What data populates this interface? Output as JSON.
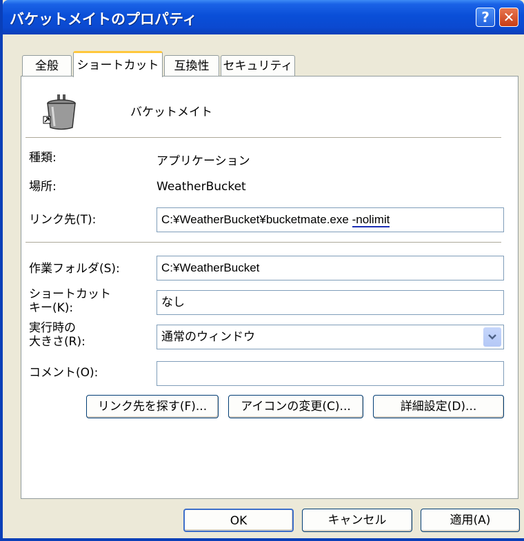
{
  "window": {
    "title": "バケットメイトのプロパティ",
    "help_glyph": "?",
    "close_glyph": "✕"
  },
  "tabs": [
    "全般",
    "ショートカット",
    "互換性",
    "セキュリティ"
  ],
  "active_tab": "ショートカット",
  "shortcut": {
    "app_icon": "bucket-app-icon",
    "name": "バケットメイト",
    "type_label": "種類:",
    "type_value": "アプリケーション",
    "location_label": "場所:",
    "location_value": "WeatherBucket",
    "target_label": "リンク先(T):",
    "target_value": "C:¥WeatherBucket¥bucketmate.exe",
    "target_arg": "-nolimit",
    "workdir_label": "作業フォルダ(S):",
    "workdir_value": "C:¥WeatherBucket",
    "hotkey_label_line1": "ショートカット",
    "hotkey_label_line2": "キー(K):",
    "hotkey_value": "なし",
    "run_label_line1": "実行時の",
    "run_label_line2": "大きさ(R):",
    "run_value": "通常のウィンドウ",
    "comment_label": "コメント(O):",
    "comment_value": ""
  },
  "buttons": {
    "find_target": "リンク先を探す(F)...",
    "change_icon": "アイコンの変更(C)...",
    "advanced": "詳細設定(D)...",
    "ok": "OK",
    "cancel": "キャンセル",
    "apply": "適用(A)"
  },
  "colors": {
    "titlebar": "#0a4fd8",
    "face": "#ece9d8",
    "active_tab_accent": "#ffc73c",
    "arg_underline": "#1a2db5"
  }
}
